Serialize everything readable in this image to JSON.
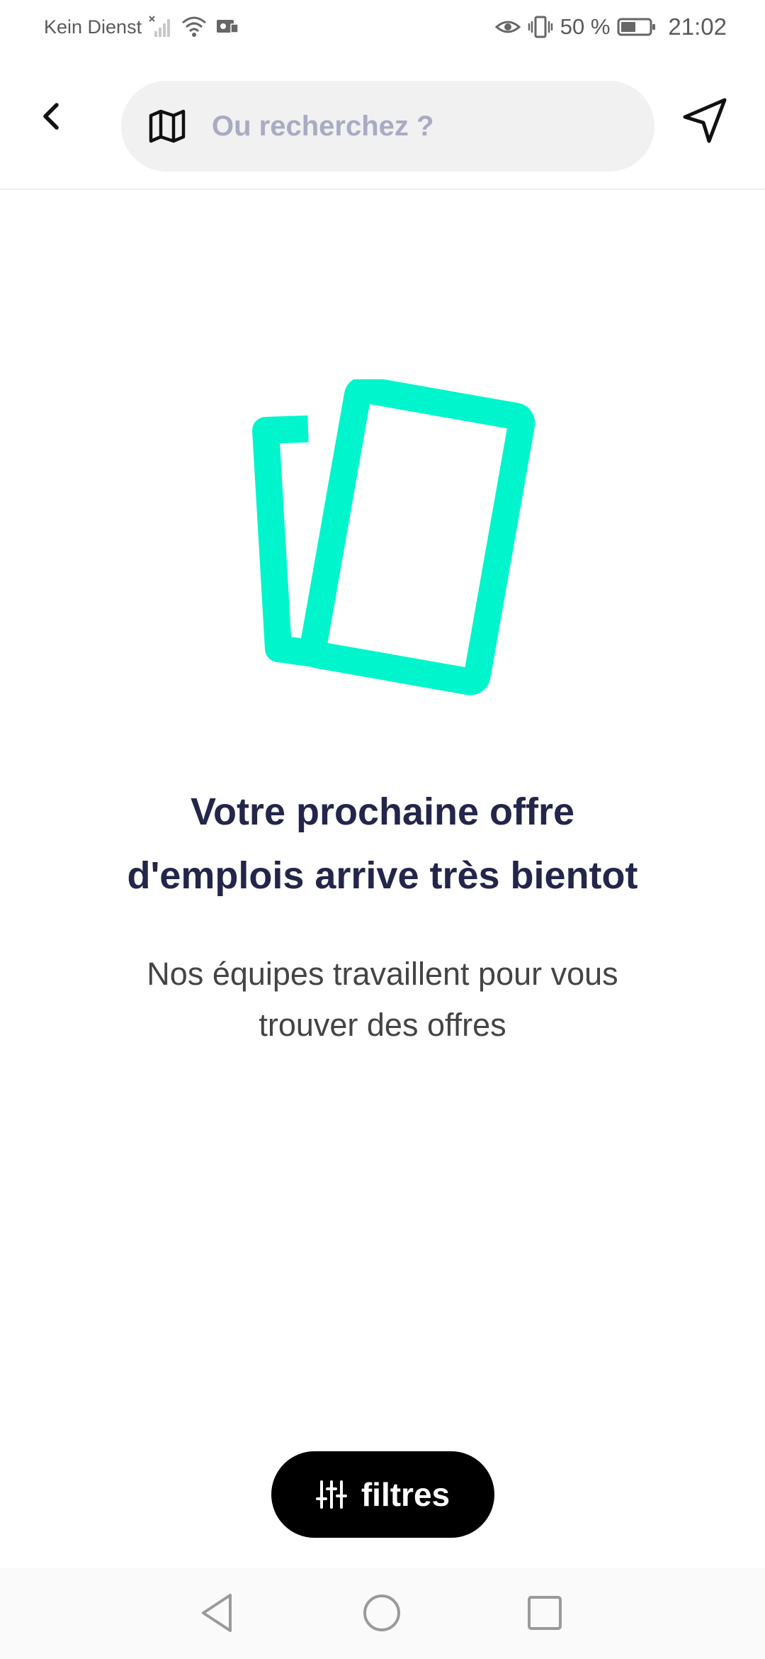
{
  "status_bar": {
    "carrier": "Kein Dienst",
    "battery_percent": "50 %",
    "time": "21:02",
    "icons": [
      "no-signal-icon",
      "wifi-icon",
      "vpn-key-icon",
      "eye-icon",
      "vibrate-icon",
      "battery-icon"
    ]
  },
  "top_bar": {
    "back_icon": "chevron-left-icon",
    "search": {
      "icon": "map-icon",
      "placeholder": "Ou recherchez ?"
    },
    "locate_icon": "navigation-arrow-icon"
  },
  "empty_state": {
    "illustration": "documents-illustration",
    "title_line1": "Votre prochaine offre",
    "title_line2": "d'emplois arrive très bientot",
    "subtitle_line1": "Nos équipes travaillent pour vous",
    "subtitle_line2": "trouver des offres"
  },
  "filter_button": {
    "icon": "sliders-icon",
    "label": "filtres"
  },
  "nav_bar": {
    "icons": [
      "nav-back-icon",
      "nav-home-icon",
      "nav-recents-icon"
    ]
  },
  "colors": {
    "accent": "#00F5CC",
    "title": "#23264A",
    "placeholder": "#A9AAC3",
    "search_bg": "#F1F1F1",
    "button_bg": "#000000"
  }
}
